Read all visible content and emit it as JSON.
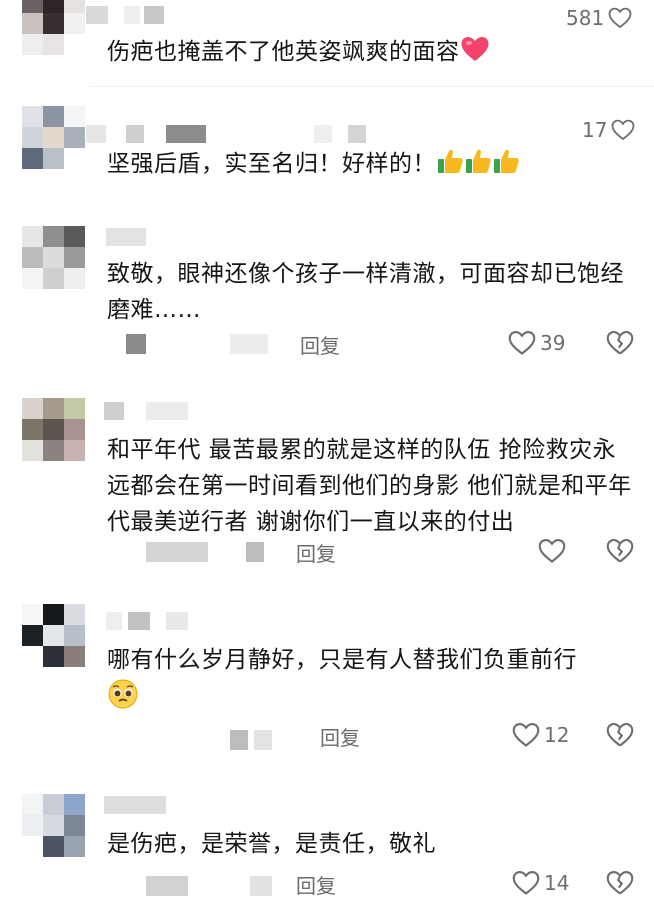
{
  "comments": [
    {
      "text": "伤疤也掩盖不了他英姿飒爽的面容",
      "like_count": "581",
      "has_reply": false
    },
    {
      "text": "坚强后盾，实至名归！好样的！",
      "like_count": "17",
      "has_reply": false
    },
    {
      "text": "致敬，眼神还像个孩子一样清澈，可面容却已饱经磨难……",
      "like_count": "39",
      "reply_label": "回复"
    },
    {
      "text": "和平年代 最苦最累的就是这样的队伍 抢险救灾永远都会在第一时间看到他们的身影 他们就是和平年代最美逆行者 谢谢你们一直以来的付出",
      "like_count": "",
      "reply_label": "回复"
    },
    {
      "text": "哪有什么岁月静好，只是有人替我们负重前行",
      "like_count": "12",
      "reply_label": "回复"
    },
    {
      "text": "是伤疤，是荣誉，是责任，敬礼",
      "like_count": "14",
      "reply_label": "回复"
    }
  ],
  "icons": {
    "like": "heart-outline-icon",
    "dislike": "broken-heart-icon",
    "heart_emoji": "red-heart-emoji",
    "thumbs_emoji": "thumbs-up-emoji",
    "pleading_emoji": "pleading-face-emoji"
  },
  "colors": {
    "text": "#161616",
    "secondary": "#6b6b6b",
    "heart_emoji": "#f4436b",
    "thumbs_emoji": "#f7b91f"
  }
}
